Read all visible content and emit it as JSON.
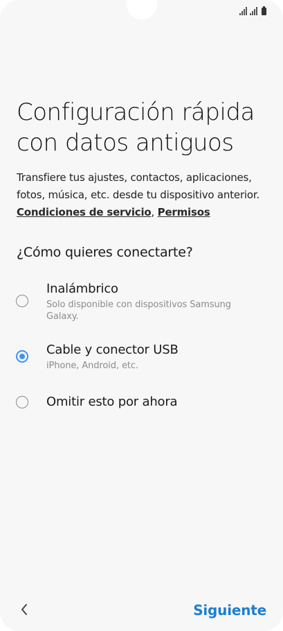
{
  "header": {
    "title": "Configuración rápida con datos antiguos",
    "description": "Transfiere tus ajustes, contactos, aplicaciones, fotos, música, etc. desde tu dispositivo anterior.",
    "link_terms": "Condiciones de servicio",
    "link_separator": ", ",
    "link_permissions": "Permisos"
  },
  "question": "¿Cómo quieres conectarte?",
  "options": [
    {
      "label": "Inalámbrico",
      "sublabel": "Solo disponible con dispositivos Samsung Galaxy.",
      "selected": false
    },
    {
      "label": "Cable y conector USB",
      "sublabel": "iPhone, Android, etc.",
      "selected": true
    },
    {
      "label": "Omitir esto por ahora",
      "sublabel": "",
      "selected": false
    }
  ],
  "footer": {
    "back_icon": "chevron-left-icon",
    "next_label": "Siguiente"
  },
  "status_bar": {
    "icons": [
      "signal-icon",
      "signal-icon",
      "battery-icon"
    ]
  },
  "colors": {
    "accent": "#3e91ff",
    "next_button": "#1d7fcf",
    "background": "#f7f7f7"
  }
}
